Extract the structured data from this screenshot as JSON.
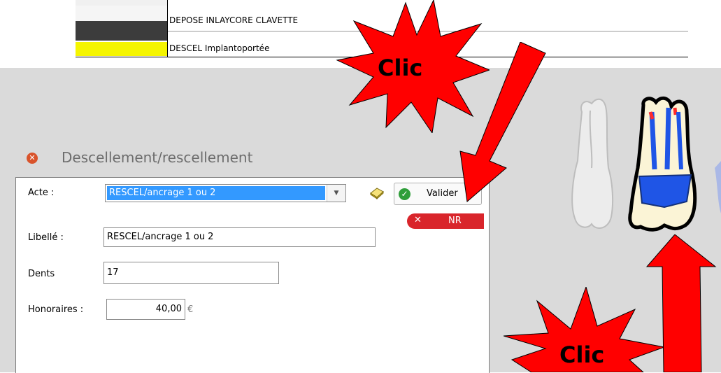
{
  "top_list": {
    "rows": [
      {
        "label": "DEPOSE INLAYCORE CLAVETTE",
        "swatch_color": "#3c3c3c"
      },
      {
        "label": "DESCEL Implantoportée",
        "swatch_color": "#f5f500"
      }
    ]
  },
  "dialog": {
    "title": "Descellement/rescellement",
    "acte_label": "Acte :",
    "acte_value": "RESCEL/ancrage 1 ou 2",
    "libelle_label": "Libellé :",
    "libelle_value": "RESCEL/ancrage 1 ou 2",
    "dents_label": "Dents",
    "dents_value": "17",
    "honoraires_label": "Honoraires :",
    "honoraires_value": "40,00",
    "currency": "€",
    "valider_label": "Valider",
    "nr_label": "NR"
  },
  "annotations": {
    "clic_top": "Clic",
    "clic_bottom": "Clic"
  },
  "colors": {
    "accent_red": "#ff0000",
    "selection_blue": "#3399ff",
    "tooth_blue": "#1f55e6"
  },
  "icons": [
    "close-icon",
    "book-icon",
    "check-icon",
    "x-icon",
    "dropdown-arrow-icon"
  ]
}
